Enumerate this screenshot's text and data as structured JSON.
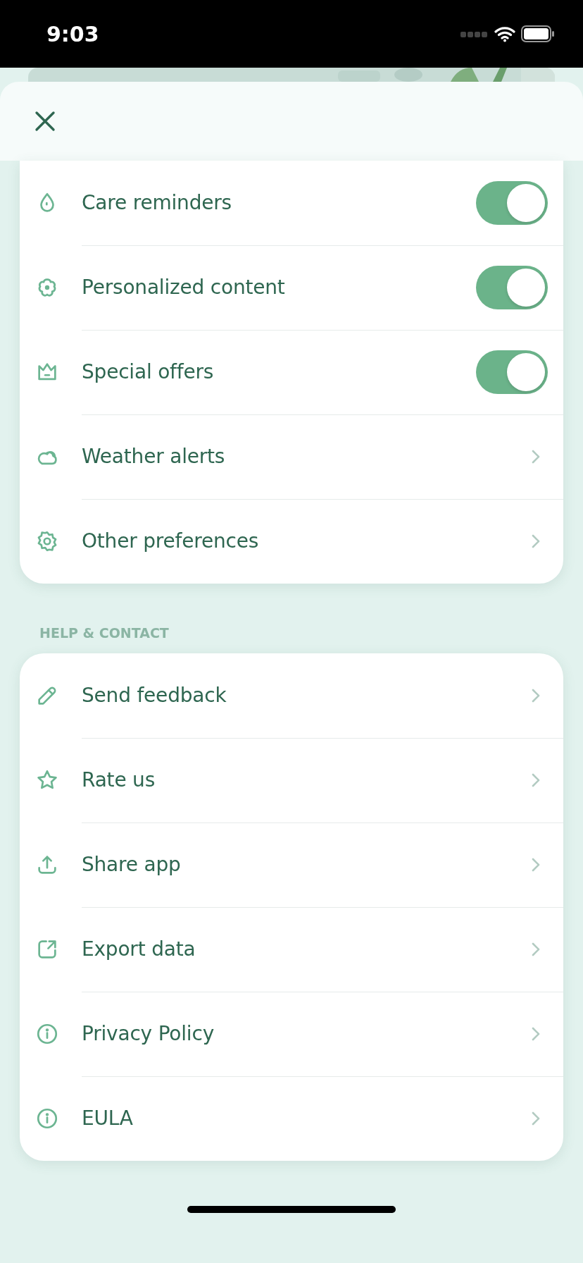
{
  "status_bar": {
    "time": "9:03"
  },
  "sections": [
    {
      "items": [
        {
          "label": "Care reminders",
          "kind": "toggle",
          "on": true
        },
        {
          "label": "Personalized content",
          "kind": "toggle",
          "on": true
        },
        {
          "label": "Special offers",
          "kind": "toggle",
          "on": true
        },
        {
          "label": "Weather alerts",
          "kind": "link"
        },
        {
          "label": "Other preferences",
          "kind": "link"
        }
      ]
    },
    {
      "title": "HELP & CONTACT",
      "items": [
        {
          "label": "Send feedback",
          "kind": "link"
        },
        {
          "label": "Rate us",
          "kind": "link"
        },
        {
          "label": "Share app",
          "kind": "link"
        },
        {
          "label": "Export data",
          "kind": "link"
        },
        {
          "label": "Privacy Policy",
          "kind": "link"
        },
        {
          "label": "EULA",
          "kind": "link"
        }
      ]
    }
  ]
}
